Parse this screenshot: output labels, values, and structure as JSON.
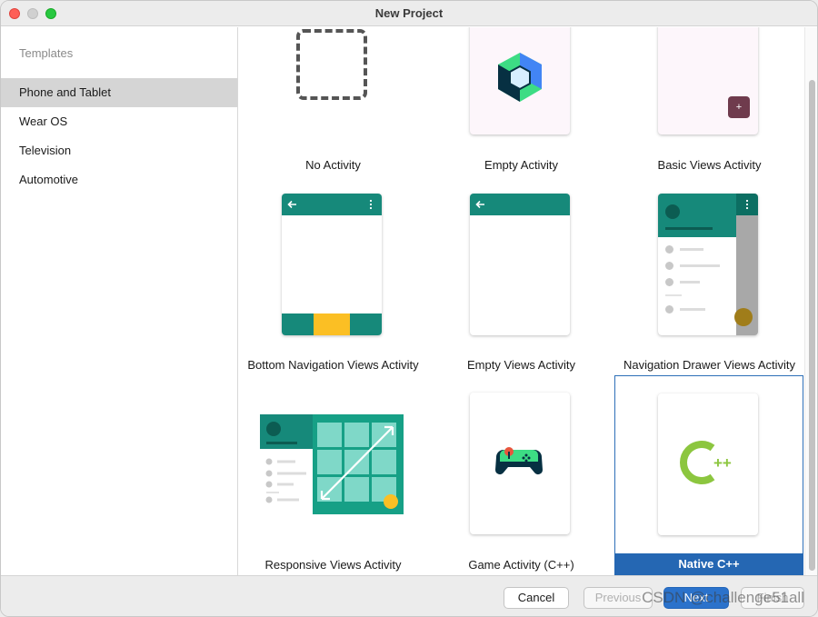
{
  "window": {
    "title": "New Project"
  },
  "sidebar": {
    "heading": "Templates",
    "items": [
      {
        "label": "Phone and Tablet",
        "selected": true
      },
      {
        "label": "Wear OS",
        "selected": false
      },
      {
        "label": "Television",
        "selected": false
      },
      {
        "label": "Automotive",
        "selected": false
      }
    ]
  },
  "templates": [
    {
      "label": "No Activity",
      "icon": "dashed-square-icon"
    },
    {
      "label": "Empty Activity",
      "icon": "compose-hexagon-icon"
    },
    {
      "label": "Basic Views Activity",
      "icon": "fab-plus-icon",
      "fab_glyph": "+"
    },
    {
      "label": "Bottom Navigation Views Activity",
      "icon": "bottom-nav-phone-icon"
    },
    {
      "label": "Empty Views Activity",
      "icon": "appbar-phone-icon"
    },
    {
      "label": "Navigation Drawer Views Activity",
      "icon": "nav-drawer-phone-icon"
    },
    {
      "label": "Responsive Views Activity",
      "icon": "responsive-tablet-icon"
    },
    {
      "label": "Game Activity (C++)",
      "icon": "gamepad-icon"
    },
    {
      "label": "Native C++",
      "icon": "cpp-logo-icon",
      "selected": true,
      "logo_text": "++"
    }
  ],
  "footer": {
    "cancel": "Cancel",
    "previous": "Previous",
    "next": "Next",
    "finish": "Finish",
    "watermark": "CSDN @challenge51all"
  },
  "colors": {
    "accent": "#2567b3",
    "teal": "#16897a",
    "teal_dark": "#0c6e62",
    "amber": "#fbbf24",
    "selected_sidebar": "#d5d5d5",
    "cpp_green": "#8cc63f"
  }
}
